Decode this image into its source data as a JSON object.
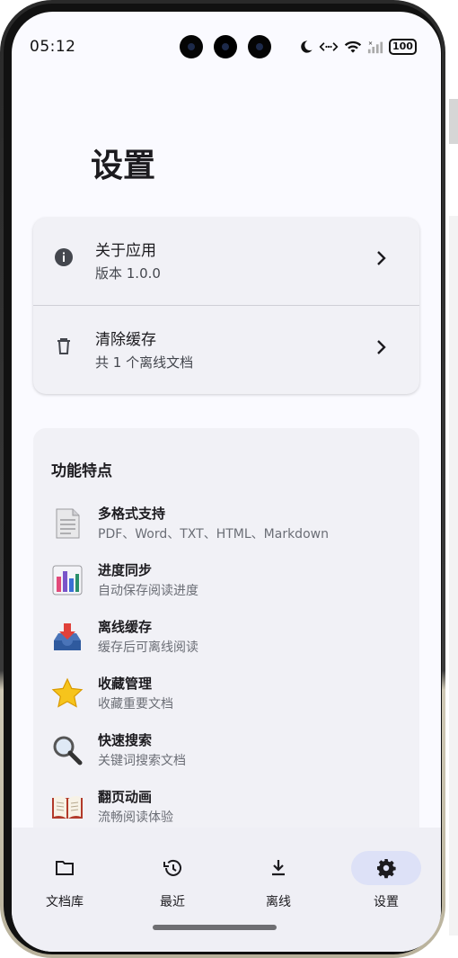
{
  "status_bar": {
    "time": "05:12",
    "battery": "100",
    "icons": [
      "moon-icon",
      "data-arrows-icon",
      "wifi-icon",
      "signal-icon",
      "battery-icon"
    ]
  },
  "page": {
    "title": "设置"
  },
  "settings": [
    {
      "title": "关于应用",
      "subtitle": "版本 1.0.0",
      "icon": "info-icon"
    },
    {
      "title": "清除缓存",
      "subtitle": "共 1 个离线文档",
      "icon": "trash-icon"
    }
  ],
  "features": {
    "title": "功能特点",
    "items": [
      {
        "title": "多格式支持",
        "desc": "PDF、Word、TXT、HTML、Markdown",
        "icon": "document-icon"
      },
      {
        "title": "进度同步",
        "desc": "自动保存阅读进度",
        "icon": "bar-chart-icon"
      },
      {
        "title": "离线缓存",
        "desc": "缓存后可离线阅读",
        "icon": "inbox-download-icon"
      },
      {
        "title": "收藏管理",
        "desc": "收藏重要文档",
        "icon": "star-icon"
      },
      {
        "title": "快速搜索",
        "desc": "关键词搜索文档",
        "icon": "magnifier-icon"
      },
      {
        "title": "翻页动画",
        "desc": "流畅阅读体验",
        "icon": "open-book-icon"
      }
    ]
  },
  "nav": {
    "items": [
      {
        "label": "文档库",
        "icon": "folder-icon",
        "active": false
      },
      {
        "label": "最近",
        "icon": "history-icon",
        "active": false
      },
      {
        "label": "离线",
        "icon": "download-icon",
        "active": false
      },
      {
        "label": "设置",
        "icon": "gear-icon",
        "active": true
      }
    ]
  },
  "colors": {
    "accent_pill": "#dde1f7",
    "screen_bg": "#fafaff",
    "card_bg": "#f1f1f6"
  }
}
